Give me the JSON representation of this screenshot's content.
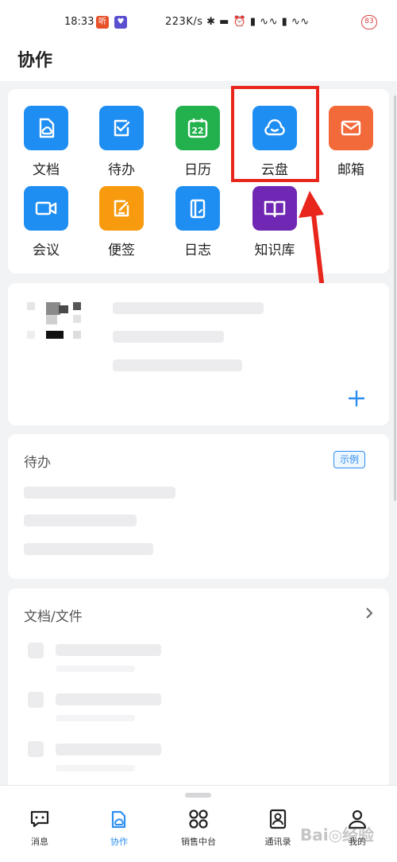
{
  "status_bar": {
    "time": "18:33",
    "badge1": "听",
    "network_speed": "223K/s",
    "battery": "83"
  },
  "header": {
    "title": "协作"
  },
  "apps": [
    {
      "label": "文档",
      "icon": "doc-cloud-icon",
      "color": "#1f8ef2"
    },
    {
      "label": "待办",
      "icon": "checkbox-icon",
      "color": "#1f8ef2"
    },
    {
      "label": "日历",
      "icon": "calendar-icon",
      "color": "#22b14c",
      "day": "22"
    },
    {
      "label": "云盘",
      "icon": "cloud-icon",
      "color": "#1f8ef2"
    },
    {
      "label": "邮箱",
      "icon": "mail-icon",
      "color": "#f2693a"
    },
    {
      "label": "会议",
      "icon": "video-icon",
      "color": "#1f8ef2"
    },
    {
      "label": "便签",
      "icon": "note-icon",
      "color": "#f79a0e"
    },
    {
      "label": "日志",
      "icon": "journal-icon",
      "color": "#1f8ef2"
    },
    {
      "label": "知识库",
      "icon": "book-icon",
      "color": "#7028b4"
    }
  ],
  "todo_card": {
    "title": "待办",
    "badge": "示例"
  },
  "files_card": {
    "title": "文档/文件"
  },
  "bottom_nav": [
    {
      "label": "消息",
      "icon": "chat-icon"
    },
    {
      "label": "协作",
      "icon": "collab-icon",
      "active": true
    },
    {
      "label": "销售中台",
      "icon": "grid-icon"
    },
    {
      "label": "通讯录",
      "icon": "contacts-icon"
    },
    {
      "label": "我的",
      "icon": "profile-icon"
    }
  ],
  "watermark": "Bai◎经验",
  "colors": {
    "accent": "#2d8ef0",
    "annotation": "#e8261c"
  }
}
